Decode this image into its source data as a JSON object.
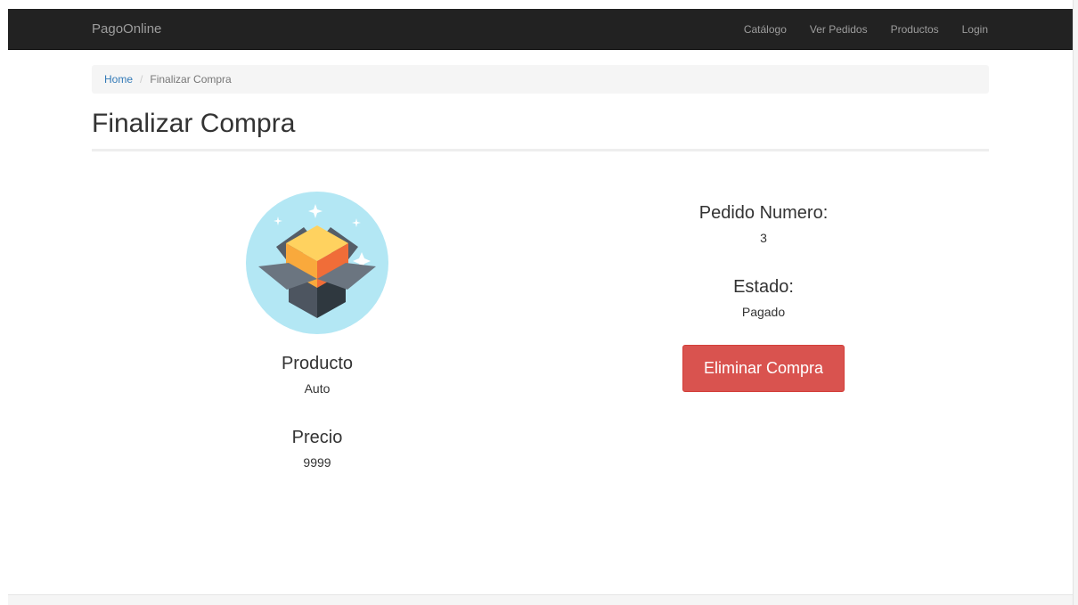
{
  "navbar": {
    "brand": "PagoOnline",
    "links": [
      "Catálogo",
      "Ver Pedidos",
      "Productos",
      "Login"
    ]
  },
  "breadcrumb": {
    "home": "Home",
    "current": "Finalizar Compra"
  },
  "page": {
    "title": "Finalizar Compra"
  },
  "product": {
    "image_icon": "open-box-icon",
    "name_label": "Producto",
    "name_value": "Auto",
    "price_label": "Precio",
    "price_value": "9999"
  },
  "order": {
    "number_label": "Pedido Numero:",
    "number_value": "3",
    "status_label": "Estado:",
    "status_value": "Pagado",
    "delete_button": "Eliminar Compra"
  },
  "colors": {
    "navbar_bg": "#222222",
    "link": "#337ab7",
    "danger": "#d9534f"
  }
}
